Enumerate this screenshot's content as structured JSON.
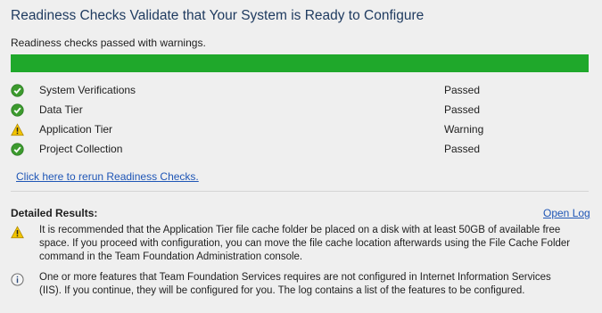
{
  "title": "Readiness Checks Validate that Your System is Ready to Configure",
  "summary": "Readiness checks passed with warnings.",
  "progress": {
    "percent": 100,
    "color": "#1fa82b"
  },
  "checks": [
    {
      "name": "System Verifications",
      "status": "Passed",
      "icon": "check-icon"
    },
    {
      "name": "Data Tier",
      "status": "Passed",
      "icon": "check-icon"
    },
    {
      "name": "Application Tier",
      "status": "Warning",
      "icon": "warning-icon"
    },
    {
      "name": "Project Collection",
      "status": "Passed",
      "icon": "check-icon"
    }
  ],
  "rerun_link": "Click here to rerun Readiness Checks.",
  "detailed": {
    "heading": "Detailed Results:",
    "open_log": "Open Log",
    "items": [
      {
        "icon": "warning-icon",
        "text": "It is recommended that the Application Tier file cache folder be placed on a disk with at least 50GB of available free space.  If you proceed with configuration, you can move the file cache location afterwards using the File Cache Folder command in the Team Foundation Administration console."
      },
      {
        "icon": "info-icon",
        "text": "One or more features that Team Foundation Services requires are not configured in Internet Information Services (IIS). If you continue, they will be configured for you. The log contains a list of the features to be configured."
      }
    ]
  },
  "colors": {
    "link": "#1f56b6",
    "passed": "#3c9a2e",
    "warning": "#f2c400"
  }
}
